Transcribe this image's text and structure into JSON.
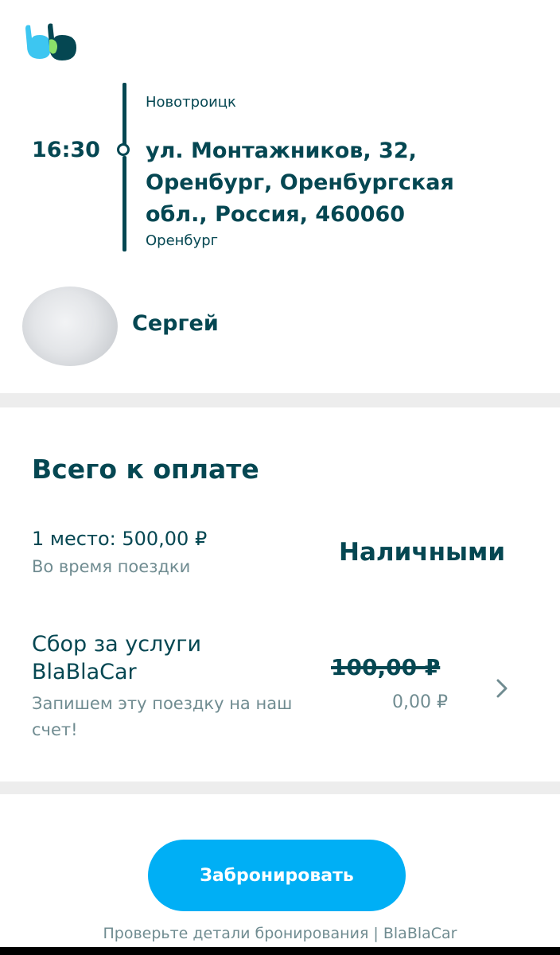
{
  "trip": {
    "from_city": "Новотроицк",
    "departure_time": "16:30",
    "address": "ул. Монтажников, 32, Оренбург, Оренбургская обл., Россия, 460060",
    "to_city": "Оренбург"
  },
  "driver": {
    "name": "Сергей"
  },
  "payment": {
    "title": "Всего к оплате",
    "seat_price": "1 место: 500,00 ₽",
    "seat_note": "Во время поездки",
    "method": "Наличными",
    "fee_title": "Сбор за услуги BlaBlaCar",
    "fee_note": "Запишем эту поездку на наш счет!",
    "fee_old": "100,00 ₽",
    "fee_new": "0,00 ₽"
  },
  "actions": {
    "book_label": "Забронировать"
  },
  "footer": {
    "text": "Проверьте детали бронирования | BlaBlaCar"
  },
  "colors": {
    "primary": "#054752",
    "accent": "#00aff5",
    "muted": "#708c91"
  },
  "icons": {
    "logo": "blablacar-logo-icon",
    "chevron": "chevron-right-icon"
  }
}
